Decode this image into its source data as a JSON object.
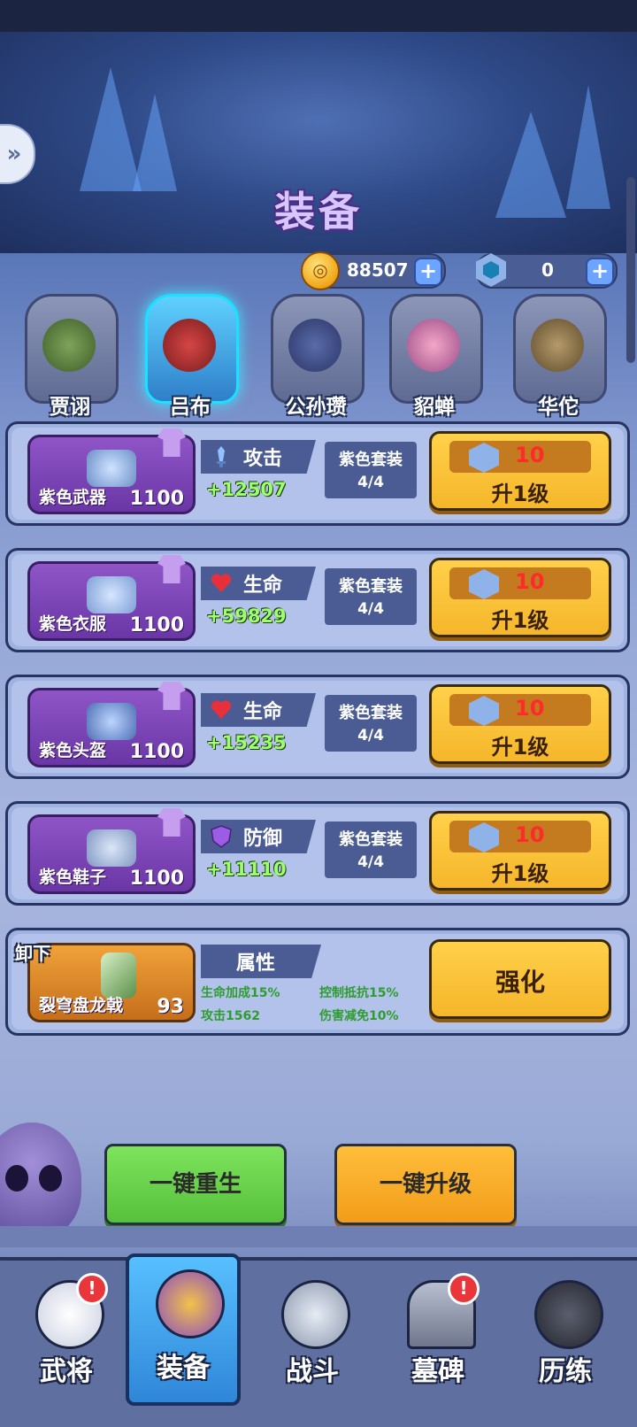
{
  "screen": {
    "title": "装备"
  },
  "resources": {
    "gold": {
      "value": "88507",
      "icon": "gold-coin-icon"
    },
    "gems": {
      "value": "0",
      "icon": "blue-gem-icon"
    }
  },
  "heroes": [
    {
      "name": "贾诩",
      "selected": false
    },
    {
      "name": "吕布",
      "selected": true
    },
    {
      "name": "公孙瓒",
      "selected": false
    },
    {
      "name": "貂蝉",
      "selected": false
    },
    {
      "name": "华佗",
      "selected": false
    }
  ],
  "equipment": [
    {
      "name": "紫色武器",
      "level": "1100",
      "stat_label": "攻击",
      "stat_icon": "sword-icon",
      "stat_value": "+12507",
      "set_label": "紫色套装",
      "set_progress": "4/4",
      "cost": "10",
      "upgrade_label": "升1级"
    },
    {
      "name": "紫色衣服",
      "level": "1100",
      "stat_label": "生命",
      "stat_icon": "heart-icon",
      "stat_value": "+59829",
      "set_label": "紫色套装",
      "set_progress": "4/4",
      "cost": "10",
      "upgrade_label": "升1级"
    },
    {
      "name": "紫色头盔",
      "level": "1100",
      "stat_label": "生命",
      "stat_icon": "heart-icon",
      "stat_value": "+15235",
      "set_label": "紫色套装",
      "set_progress": "4/4",
      "cost": "10",
      "upgrade_label": "升1级"
    },
    {
      "name": "紫色鞋子",
      "level": "1100",
      "stat_label": "防御",
      "stat_icon": "shield-icon",
      "stat_value": "+11110",
      "set_label": "紫色套装",
      "set_progress": "4/4",
      "cost": "10",
      "upgrade_label": "升1级"
    }
  ],
  "artifact": {
    "unequip_label": "卸下",
    "name": "裂穹盘龙戟",
    "level": "93",
    "attr_title": "属性",
    "props": [
      "生命加成15%",
      "攻击1562",
      "控制抵抗15%",
      "伤害减免10%"
    ],
    "enhance_label": "强化"
  },
  "actions": {
    "rebirth_label": "一键重生",
    "upgrade_all_label": "一键升级"
  },
  "nav": [
    {
      "label": "武将",
      "icon": "skull-icon",
      "badge": "!",
      "active": false
    },
    {
      "label": "装备",
      "icon": "helmet-icon",
      "badge": "",
      "active": true
    },
    {
      "label": "战斗",
      "icon": "crossed-swords-icon",
      "badge": "",
      "active": false
    },
    {
      "label": "墓碑",
      "icon": "tombstone-icon",
      "badge": "!",
      "active": false
    },
    {
      "label": "历练",
      "icon": "fist-icon",
      "badge": "",
      "active": false
    }
  ],
  "colors": {
    "gold": "#f5b62a",
    "purple": "#7b43b6",
    "green_text": "#9cff6e",
    "red_cost": "#ff2a2a"
  }
}
